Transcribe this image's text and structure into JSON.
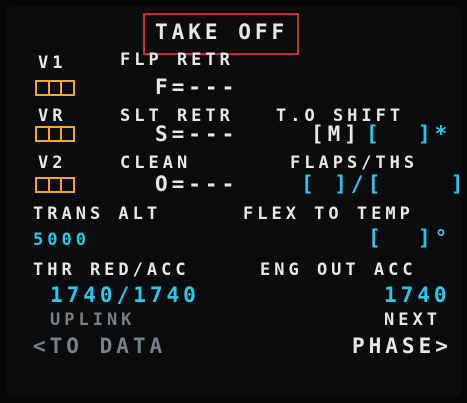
{
  "title": "TAKE OFF",
  "v1": {
    "label": "V1"
  },
  "vr": {
    "label": "VR"
  },
  "v2": {
    "label": "V2"
  },
  "flp_retr": {
    "label": "FLP RETR",
    "value": "F=---"
  },
  "slt_retr": {
    "label": "SLT RETR",
    "value": "S=---"
  },
  "clean": {
    "label": "CLEAN",
    "value": "O=---"
  },
  "to_shift": {
    "label": "T.O SHIFT",
    "unit": "[M]",
    "field_open": "[",
    "field_close": "]*"
  },
  "flaps_ths": {
    "label": "FLAPS/THS",
    "value": "[ ]/[    ]"
  },
  "trans_alt": {
    "label": "TRANS ALT",
    "value": "5000"
  },
  "flex_to_temp": {
    "label": "FLEX TO TEMP",
    "value_open": "[",
    "value_close": "]°"
  },
  "thr_red_acc": {
    "label": "THR RED/ACC",
    "value": "1740/1740"
  },
  "eng_out_acc": {
    "label": "ENG OUT ACC",
    "value": "1740"
  },
  "uplink": {
    "label": "UPLINK",
    "action": "<TO DATA"
  },
  "next_phase": {
    "line1": "NEXT",
    "line2": "PHASE>"
  },
  "colors": {
    "white": "#e8e8e8",
    "cyan": "#28c8ec",
    "amber": "#f5a623",
    "gray": "#7b8084",
    "highlight": "#cc2b2b"
  }
}
